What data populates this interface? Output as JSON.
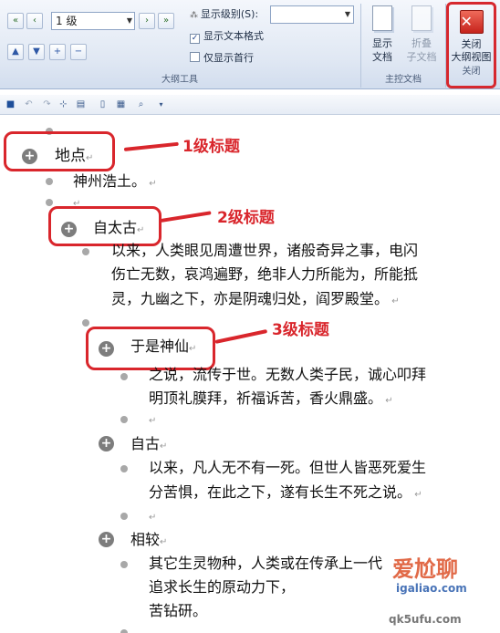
{
  "ribbon": {
    "level_combo_value": "1 级",
    "show_level_label": "显示级别(S):",
    "show_text_format_label": "显示文本格式",
    "show_text_format_checked": true,
    "show_first_line_label": "仅显示首行",
    "show_first_line_checked": false,
    "outline_tools_group": "大纲工具",
    "show_document_label": [
      "显示",
      "文档"
    ],
    "collapse_subdocs_label": [
      "折叠",
      "子文档"
    ],
    "master_document_group": "主控文档",
    "close_outline_label": [
      "关闭",
      "大纲视图"
    ],
    "close_group": "关闭"
  },
  "document": {
    "item1_heading": "地点",
    "item1_body": "神州浩土。",
    "item2_heading": "自太古",
    "item2_body_lines": [
      "以来，人类眼见周遭世界，诸般奇异之事，电闪",
      "伤亡无数，哀鸿遍野，绝非人力所能为，所能抵",
      "灵，九幽之下，亦是阴魂归处，阎罗殿堂。"
    ],
    "item3_heading": "于是神仙",
    "item3_body_lines": [
      "之说，流传于世。无数人类子民，诚心叩拜",
      "明顶礼膜拜，祈福诉苦，香火鼎盛。"
    ],
    "item4_heading": "自古",
    "item4_body_lines": [
      "以来，凡人无不有一死。但世人皆恶死爱生",
      "分苦惧，在此之下，遂有长生不死之说。"
    ],
    "item5_heading": "相较",
    "item5_body_lines": [
      "其它生灵物种，人类或在传承上一代",
      "追求长生的原动力下，",
      "苦钻研。"
    ]
  },
  "annotations": {
    "level1": "1级标题",
    "level2": "2级标题",
    "level3": "3级标题",
    "color": "#d9262c"
  },
  "watermark": {
    "brand": "爱尬聊",
    "url": "igaliao.com",
    "url2": "qk5ufu.com"
  }
}
